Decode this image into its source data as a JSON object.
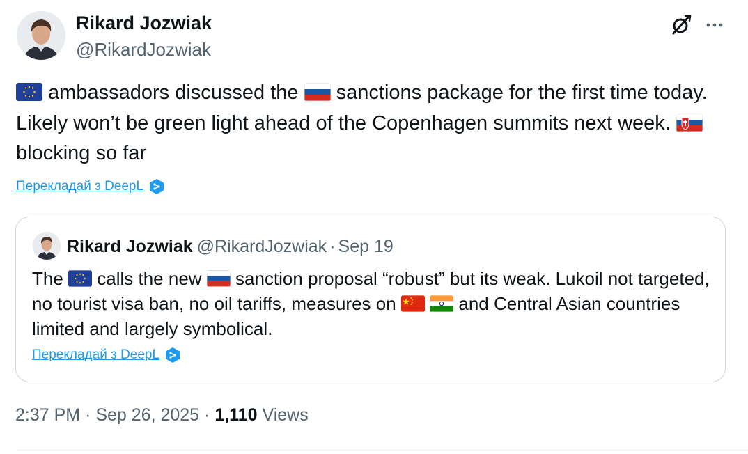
{
  "tweet": {
    "author_name": "Rikard Jozwiak",
    "author_handle": "@RikardJozwiak",
    "text_parts": [
      " ambassadors discussed the ",
      " sanctions package for the first time today. Likely won’t be green light ahead of the Copenhagen summits next week. ",
      " blocking so far"
    ],
    "flags": [
      "eu-flag-icon",
      "russia-flag-icon",
      "slovakia-flag-icon"
    ],
    "translate_label": "Перекладай з DeepL",
    "time": "2:37 PM",
    "date": "Sep 26, 2025",
    "views_count": "1,110",
    "views_label": "Views"
  },
  "quote": {
    "author_name": "Rikard Jozwiak",
    "author_handle": "@RikardJozwiak",
    "date": "Sep 19",
    "text_parts": [
      "The ",
      " calls the new ",
      " sanction proposal “robust” but its weak. Lukoil not targeted, no tourist visa ban, no oil tariffs, measures on ",
      " and Central Asian countries limited and largely symbolical."
    ],
    "flags": [
      "eu-flag-icon",
      "russia-flag-icon",
      "china-flag-icon",
      "india-flag-icon"
    ],
    "translate_label": "Перекладай з DeepL"
  },
  "separator": "·",
  "colors": {
    "text": "#0f1419",
    "secondary": "#536471",
    "link": "#1d9bf0",
    "border": "#cfd9de"
  }
}
